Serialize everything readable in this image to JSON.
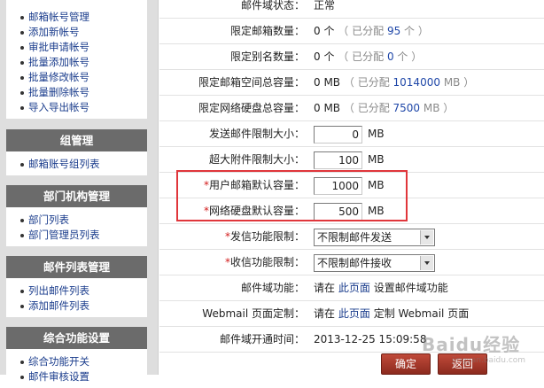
{
  "sidebar": {
    "account_links": [
      "邮箱帐号管理",
      "添加新帐号",
      "审批申请帐号",
      "批量添加帐号",
      "批量修改帐号",
      "批量删除帐号",
      "导入导出帐号"
    ],
    "group": {
      "title": "组管理",
      "items": [
        "邮箱账号组列表"
      ]
    },
    "dept": {
      "title": "部门机构管理",
      "items": [
        "部门列表",
        "部门管理员列表"
      ]
    },
    "maillist": {
      "title": "邮件列表管理",
      "items": [
        "列出邮件列表",
        "添加邮件列表"
      ]
    },
    "general": {
      "title": "综合功能设置",
      "items": [
        "综合功能开关",
        "邮件审核设置"
      ]
    }
  },
  "form": {
    "status": {
      "label": "邮件域状态：",
      "value": "正常"
    },
    "mailbox_quota": {
      "label": "限定邮箱数量：",
      "value": "0 个",
      "assigned_prefix": "（ 已分配",
      "assigned": "95",
      "assigned_suffix": "个 ）"
    },
    "alias_quota": {
      "label": "限定别名数量：",
      "value": "0 个",
      "assigned_prefix": "（ 已分配",
      "assigned": "0",
      "assigned_suffix": "个 ）"
    },
    "mailbox_space": {
      "label": "限定邮箱空间总容量：",
      "value": "0 MB",
      "assigned_prefix": "（ 已分配",
      "assigned": "1014000",
      "assigned_suffix": "MB ）"
    },
    "disk_space": {
      "label": "限定网络硬盘总容量：",
      "value": "0 MB",
      "assigned_prefix": "（ 已分配",
      "assigned": "7500",
      "assigned_suffix": "MB ）"
    },
    "send_limit": {
      "label": "发送邮件限制大小：",
      "value": "0",
      "unit": "MB"
    },
    "attach_limit": {
      "label": "超大附件限制大小：",
      "value": "100",
      "unit": "MB"
    },
    "user_mailbox_default": {
      "required": "*",
      "label": "用户邮箱默认容量：",
      "value": "1000",
      "unit": "MB"
    },
    "disk_default": {
      "required": "*",
      "label": "网络硬盘默认容量：",
      "value": "500",
      "unit": "MB"
    },
    "send_restrict": {
      "required": "*",
      "label": "发信功能限制：",
      "selected": "不限制邮件发送"
    },
    "recv_restrict": {
      "required": "*",
      "label": "收信功能限制：",
      "selected": "不限制邮件接收"
    },
    "domain_func": {
      "label": "邮件域功能：",
      "pre": "请在",
      "link": "此页面",
      "post": "设置邮件域功能"
    },
    "webmail": {
      "label": "Webmail 页面定制：",
      "pre": "请在",
      "link": "此页面",
      "post": "定制 Webmail 页面"
    },
    "opened_time": {
      "label": "邮件域开通时间：",
      "value": "2013-12-25 15:09:58"
    }
  },
  "buttons": {
    "confirm": "确定",
    "back": "返回"
  },
  "watermark": {
    "text": "Baidu经验",
    "sub": "jingyan.baidu.com"
  },
  "colors": {
    "highlight": "#e0363b",
    "section_header": "#6b6b6b",
    "button": "#a53a2c",
    "link": "#1a3c8c"
  }
}
